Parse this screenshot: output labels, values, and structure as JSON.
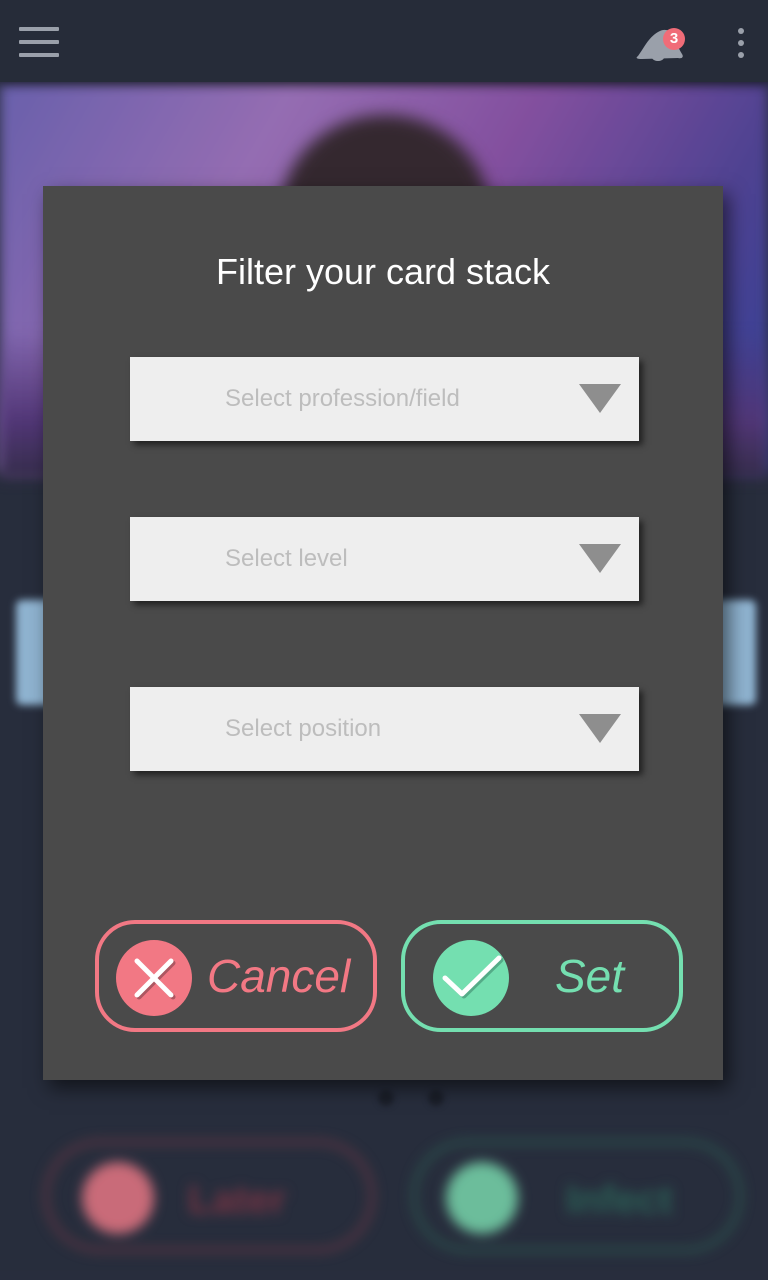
{
  "appbar": {
    "notification_count": "3"
  },
  "background": {
    "later_label": "Later",
    "infect_label": "Infect"
  },
  "dialog": {
    "title": "Filter your card stack",
    "selects": {
      "profession": {
        "placeholder": "Select profession/field"
      },
      "level": {
        "placeholder": "Select level"
      },
      "position": {
        "placeholder": "Select position"
      }
    },
    "cancel_label": "Cancel",
    "set_label": "Set"
  },
  "colors": {
    "cancel_accent": "#f27884",
    "set_accent": "#74dfb0",
    "dialog_bg": "#4a4a4a",
    "appbar_bg": "#262c39"
  },
  "icons": {
    "menu": "hamburger-menu-icon",
    "notifications": "bell-icon",
    "overflow": "more-vertical-icon",
    "dropdown": "triangle-down-icon",
    "cancel": "close-x-icon",
    "set": "checkmark-icon"
  }
}
